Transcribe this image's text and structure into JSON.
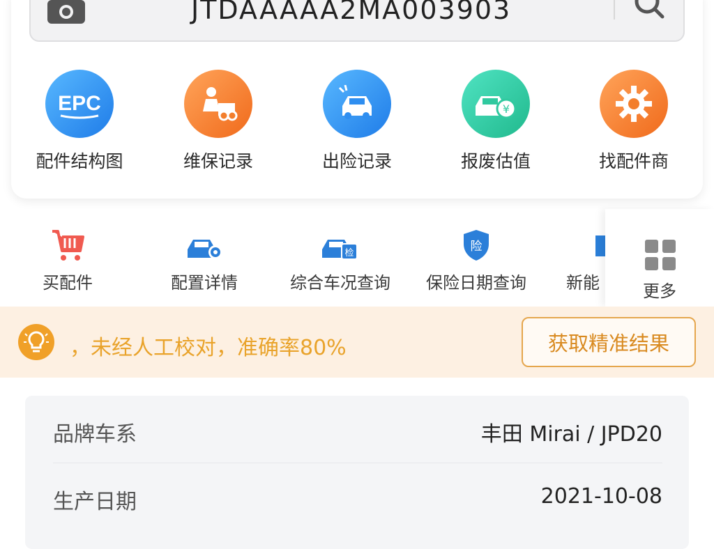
{
  "search": {
    "vin": "JTDAAAAA2MA003903"
  },
  "features": [
    {
      "label": "配件结构图",
      "icon": "epc-icon",
      "icon_text": "EPC",
      "color": "#2f8ef0"
    },
    {
      "label": "维保记录",
      "icon": "repair-icon",
      "color": "#f37e2c"
    },
    {
      "label": "出险记录",
      "icon": "car-accident-icon",
      "color": "#2f8ef0"
    },
    {
      "label": "报废估值",
      "icon": "car-valuation-icon",
      "icon_text": "¥",
      "color": "#30c99f"
    },
    {
      "label": "找配件商",
      "icon": "gear-icon",
      "color": "#f37e2c"
    }
  ],
  "quick_links": [
    {
      "label": "买配件",
      "icon": "cart-icon"
    },
    {
      "label": "配置详情",
      "icon": "car-settings-icon"
    },
    {
      "label": "综合车况查询",
      "icon": "car-inspect-icon",
      "icon_text": "检"
    },
    {
      "label": "保险日期查询",
      "icon": "shield-icon",
      "icon_text": "险"
    },
    {
      "label": "新能",
      "icon": "new-energy-icon"
    }
  ],
  "more": {
    "label": "更多",
    "icon": "grid-icon"
  },
  "notice": {
    "text": "，未经人工校对，准确率80%",
    "button": "获取精准结果",
    "text_color": "#e9a32b",
    "accent": "#f0a028"
  },
  "info": [
    {
      "key": "品牌车系",
      "value": "丰田 Mirai / JPD20"
    },
    {
      "key": "生产日期",
      "value": "2021-10-08"
    }
  ]
}
